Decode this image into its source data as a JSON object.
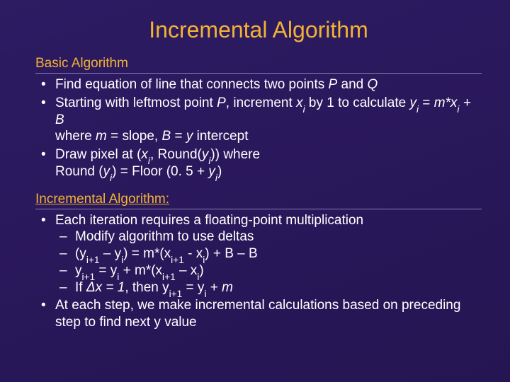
{
  "title": "Incremental Algorithm",
  "section1": {
    "heading": "Basic Algorithm",
    "b1_a": "Find equation of line that connects two points ",
    "b1_P": "P",
    "b1_b": " and ",
    "b1_Q": "Q",
    "b2_a": "Starting with leftmost point ",
    "b2_P": "P",
    "b2_b": ", increment ",
    "b2_x": "x",
    "b2_i1": "i",
    "b2_c": " by 1 to calculate ",
    "b2_y": "y",
    "b2_i2": "i",
    "b2_d": " = ",
    "b2_m": "m*x",
    "b2_i3": "i",
    "b2_e": " + B",
    "b2_line2a": "where ",
    "b2_mm": "m",
    "b2_line2b": " = slope, ",
    "b2_B": "B",
    "b2_line2c": " = ",
    "b2_yy": "y",
    "b2_line2d": " intercept",
    "b3_a": "Draw pixel at (",
    "b3_x": "x",
    "b3_i1": "i",
    "b3_b": ", Round(",
    "b3_y": "y",
    "b3_i2": "i",
    "b3_c": ")) where",
    "b3_l2a": "Round (",
    "b3_y2": "y",
    "b3_i3": "i",
    "b3_l2b": ") = Floor (0. 5 + ",
    "b3_y3": "y",
    "b3_i4": "i",
    "b3_l2c": ")"
  },
  "section2": {
    "heading": "Incremental Algorithm:",
    "b1": "Each iteration requires a floating-point multiplication",
    "d1": "Modify algorithm to use deltas",
    "d2_a": "(y",
    "d2_s1": "i+1",
    "d2_b": " – y",
    "d2_s2": "i",
    "d2_c": ") = m*(x",
    "d2_s3": "i+1",
    "d2_d": " - x",
    "d2_s4": "i",
    "d2_e": ") + B – B",
    "d3_a": "y",
    "d3_s1": "i+1",
    "d3_b": " = y",
    "d3_s2": "i",
    "d3_c": " + m*(x",
    "d3_s3": "i+1",
    "d3_d": " – x",
    "d3_s4": "i",
    "d3_e": ")",
    "d4_a": "If ",
    "d4_dx": "Δx = 1",
    "d4_b": ", then y",
    "d4_s1": "i+1",
    "d4_c": " = y",
    "d4_s2": "i",
    "d4_d": " + ",
    "d4_m": "m",
    "b2": "At each step, we make incremental calculations based on preceding step to find next y value"
  }
}
